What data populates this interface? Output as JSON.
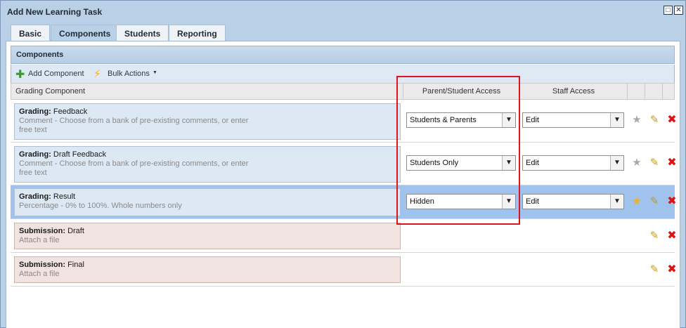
{
  "window": {
    "title": "Add New Learning Task"
  },
  "tabs": [
    {
      "label": "Basic"
    },
    {
      "label": "Components"
    },
    {
      "label": "Students"
    },
    {
      "label": "Reporting"
    }
  ],
  "panel": {
    "title": "Components",
    "toolbar": {
      "add_label": "Add Component",
      "bulk_label": "Bulk Actions"
    },
    "columns": {
      "grading_component": "Grading Component",
      "parent_student_access": "Parent/Student Access",
      "staff_access": "Staff Access"
    }
  },
  "rows": [
    {
      "kind": "Grading:",
      "name": " Feedback",
      "desc": "Comment - Choose from a bank of pre-existing comments, or enter free text",
      "access": "Students & Parents",
      "staff": "Edit"
    },
    {
      "kind": "Grading:",
      "name": " Draft Feedback",
      "desc": "Comment - Choose from a bank of pre-existing comments, or enter free text",
      "access": "Students Only",
      "staff": "Edit"
    },
    {
      "kind": "Grading:",
      "name": " Result",
      "desc": "Percentage - 0% to 100%. Whole numbers only",
      "access": "Hidden",
      "staff": "Edit"
    },
    {
      "kind": "Submission:",
      "name": " Draft",
      "desc": "Attach a file"
    },
    {
      "kind": "Submission:",
      "name": " Final",
      "desc": "Attach a file"
    }
  ],
  "colors": {
    "accent": "#b9d0e6",
    "selected_row": "#9fc3ec",
    "highlight_box": "#e0141e"
  }
}
